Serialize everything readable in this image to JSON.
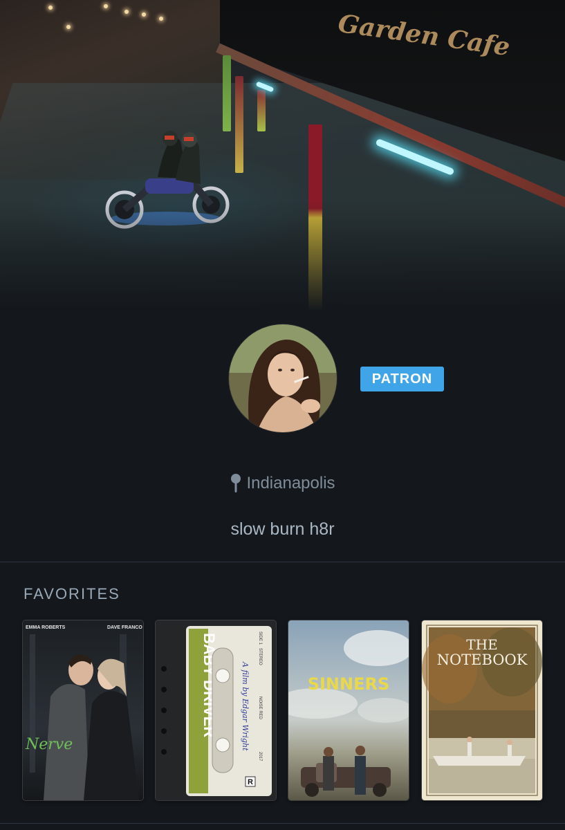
{
  "profile": {
    "badge": "PATRON",
    "location": "Indianapolis",
    "bio": "slow burn h8r"
  },
  "backdrop": {
    "sign_line1": "Garden Cafe"
  },
  "favorites": {
    "heading": "FAVORITES",
    "films": [
      {
        "title": "Nerve",
        "credits_left": "EMMA ROBERTS",
        "credits_right": "DAVE FRANCO"
      },
      {
        "title": "BABY DRIVER",
        "tagline": "A film by Edgar Wright",
        "label_side": "SIDE 1",
        "label_stereo": "STEREO",
        "label_noise": "NOISE RED",
        "label_year": "2017",
        "rating": "R"
      },
      {
        "title": "SINNERS"
      },
      {
        "title_line1": "THE",
        "title_line2": "NOTEBOOK"
      }
    ]
  },
  "colors": {
    "background": "#14181c",
    "badge": "#40a5e8",
    "heading": "#9aa9b8",
    "location": "#7f8d9b",
    "bio": "#aab8c5"
  }
}
